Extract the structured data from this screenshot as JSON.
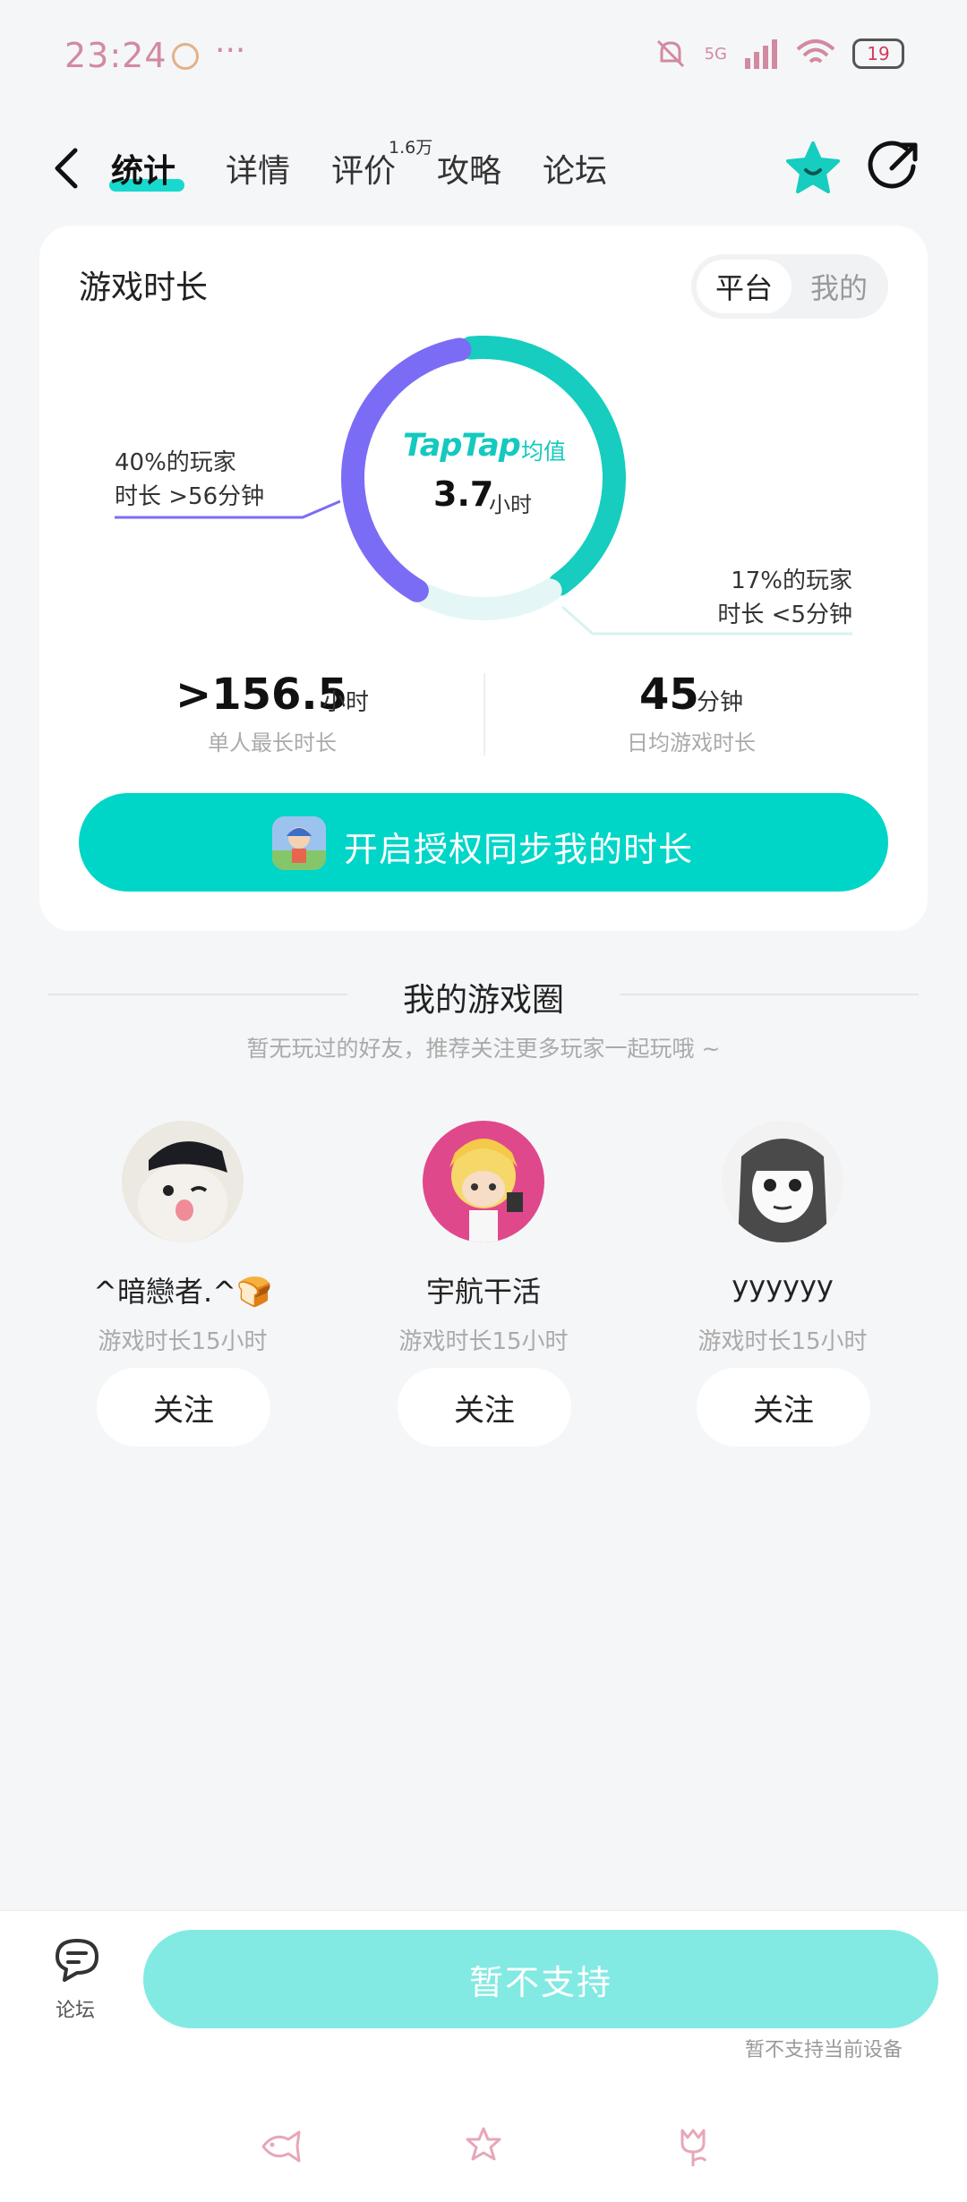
{
  "status_bar": {
    "time": "23:24",
    "dots": "···",
    "network": "5G",
    "battery": "19"
  },
  "nav": {
    "tabs": [
      {
        "label": "统计",
        "active": true
      },
      {
        "label": "详情",
        "active": false
      },
      {
        "label": "评价",
        "active": false,
        "badge": "1.6万"
      },
      {
        "label": "攻略",
        "active": false
      },
      {
        "label": "论坛",
        "active": false
      }
    ],
    "icons": [
      "back-icon",
      "star-icon",
      "share-icon"
    ],
    "accent": "#00d6c8"
  },
  "stats_card": {
    "title": "游戏时长",
    "segment": {
      "selected": "平台",
      "other": "我的"
    },
    "ring": {
      "brand": "TapTap",
      "avg_label": "均值",
      "avg_value": "3.7",
      "avg_unit": "小时",
      "segments": [
        {
          "share": 0.4,
          "color": "#7b6cf6"
        },
        {
          "share": 0.43,
          "color": "#16cdbf"
        },
        {
          "share": 0.17,
          "color": "#e4f7f6"
        }
      ],
      "left_note": [
        "40%的玩家",
        "时长 >56分钟"
      ],
      "right_note": [
        "17%的玩家",
        "时长 <5分钟"
      ]
    },
    "stats": [
      {
        "value": ">156.5",
        "unit": "小时",
        "label": "单人最长时长"
      },
      {
        "value": "45",
        "unit": "分钟",
        "label": "日均游戏时长"
      }
    ],
    "sync_button": "开启授权同步我的时长"
  },
  "game_circle": {
    "title": "我的游戏圈",
    "subtitle": "暂无玩过的好友，推荐关注更多玩家一起玩哦 ~",
    "users": [
      {
        "name": "^暗戀者.^🍞",
        "playtime": "游戏时长15小时",
        "follow": "关注",
        "avatar": "cat-avatar"
      },
      {
        "name": "宇航干活",
        "playtime": "游戏时长15小时",
        "follow": "关注",
        "avatar": "anime-avatar"
      },
      {
        "name": "yyyyyy",
        "playtime": "游戏时长15小时",
        "follow": "关注",
        "avatar": "manga-avatar"
      }
    ]
  },
  "bottom": {
    "forum_label": "论坛",
    "main_button": "暂不支持",
    "note": "暂不支持当前设备"
  }
}
